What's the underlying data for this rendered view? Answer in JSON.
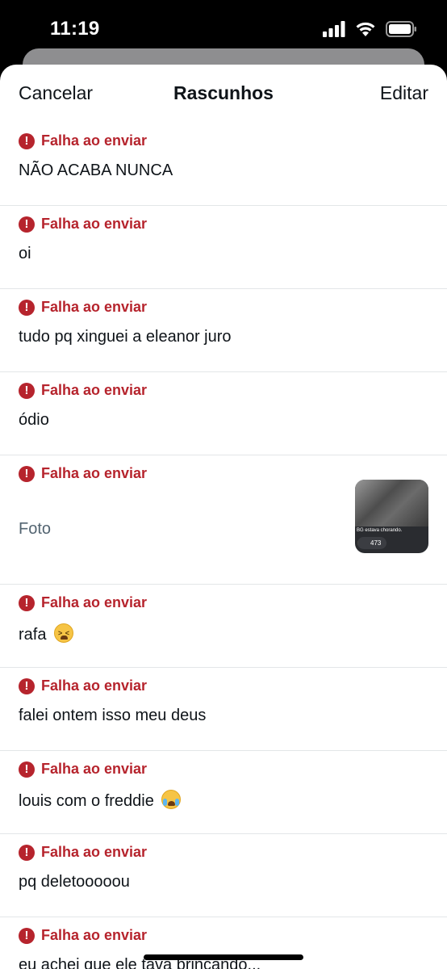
{
  "status": {
    "time": "11:19"
  },
  "nav": {
    "cancel": "Cancelar",
    "title": "Rascunhos",
    "edit": "Editar"
  },
  "drafts": [
    {
      "status": "Falha ao enviar",
      "text": "NÃO ACABA NUNCA"
    },
    {
      "status": "Falha ao enviar",
      "text": "oi"
    },
    {
      "status": "Falha ao enviar",
      "text": "tudo pq xinguei a eleanor juro"
    },
    {
      "status": "Falha ao enviar",
      "text": "ódio"
    },
    {
      "status": "Falha ao enviar",
      "text": "Foto",
      "thumbnail": {
        "caption": "BG estava chorando.",
        "count": "473"
      }
    },
    {
      "status": "Falha ao enviar",
      "text": "rafa",
      "emoji": "tired-face"
    },
    {
      "status": "Falha ao enviar",
      "text": "falei ontem isso meu deus"
    },
    {
      "status": "Falha ao enviar",
      "text": "louis com o freddie",
      "emoji": "crying-face"
    },
    {
      "status": "Falha ao enviar",
      "text": "pq deletooooou"
    },
    {
      "status": "Falha ao enviar",
      "text": "eu achei que ele tava brincando..."
    }
  ],
  "colors": {
    "error": "#b6242d",
    "text": "#0f1419",
    "muted": "#536471"
  }
}
